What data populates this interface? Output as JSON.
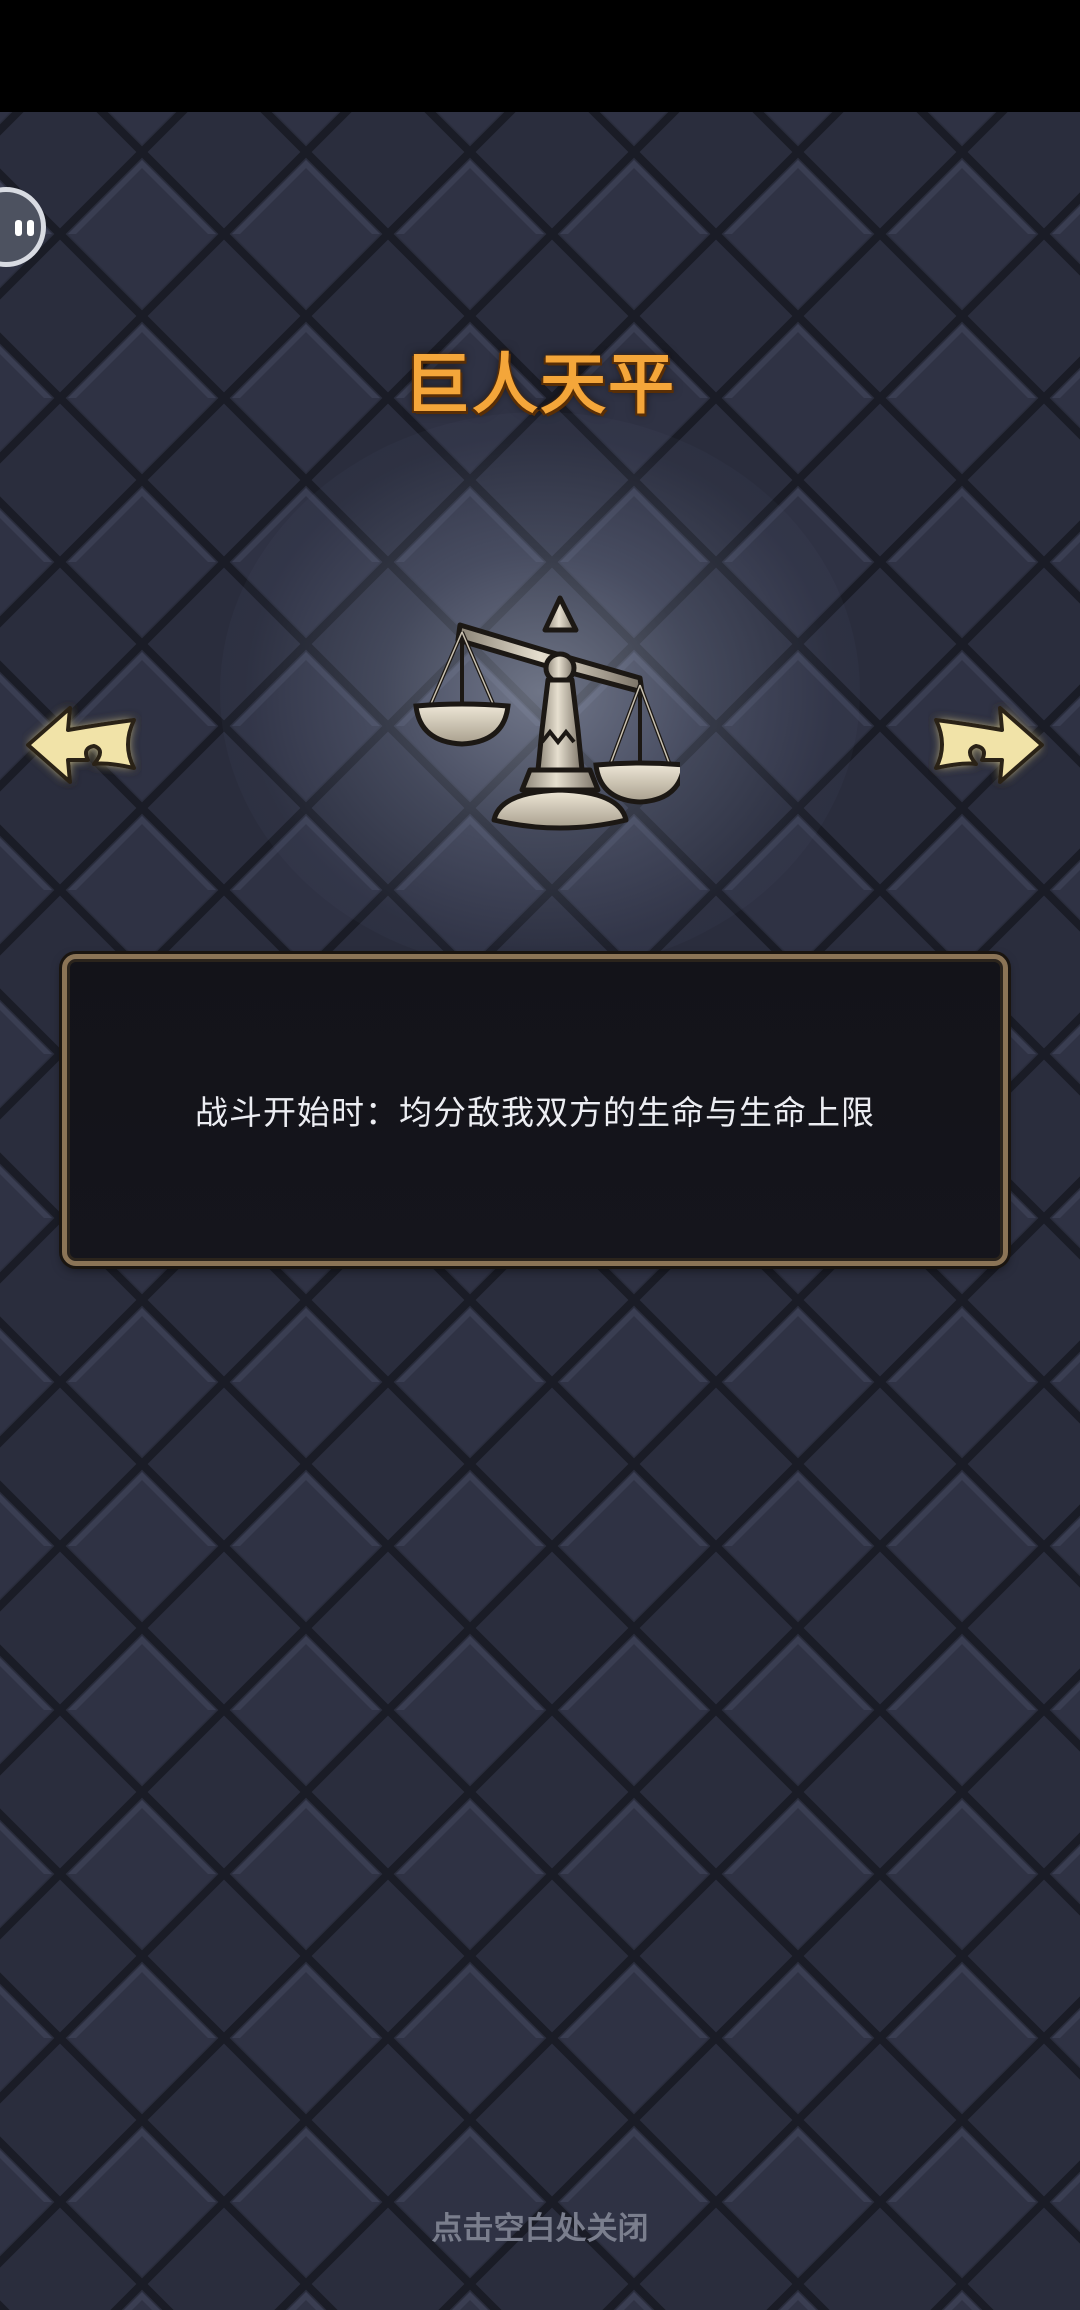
{
  "relic": {
    "name": "巨人天平",
    "description": "战斗开始时：均分敌我双方的生命与生命上限",
    "icon": "balance-scale-icon"
  },
  "navigation": {
    "previous_icon": "arrow-left-icon",
    "next_icon": "arrow-right-icon"
  },
  "footer": {
    "close_hint": "点击空白处关闭"
  },
  "overlay": {
    "floating_button_icon": "floating-assistant-icon"
  },
  "colors": {
    "title": "#f4a63a",
    "panel_border": "#8b7456",
    "background": "#2a2d3d",
    "hint_text": "#7a7e8d",
    "arrow_fill": "#f1e3a8"
  }
}
